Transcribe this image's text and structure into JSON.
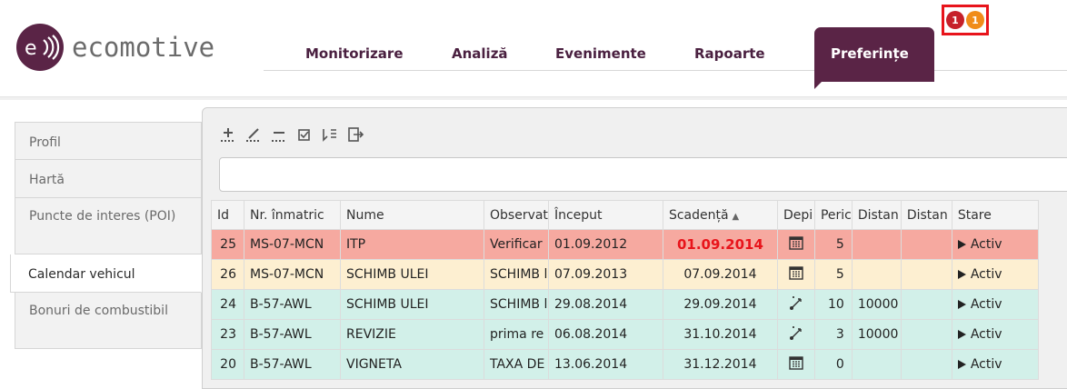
{
  "app": {
    "brand": "ecomotive"
  },
  "nav": {
    "items": [
      "Monitorizare",
      "Analiză",
      "Evenimente",
      "Rapoarte"
    ],
    "active": "Preferințe"
  },
  "notifications": {
    "badges": [
      "1",
      "1"
    ]
  },
  "sidebar": {
    "items": [
      {
        "label": "Profil"
      },
      {
        "label": "Hartă"
      },
      {
        "label": "Puncte de interes (POI)"
      },
      {
        "label": "Calendar vehicul"
      },
      {
        "label": "Bonuri de combustibil"
      }
    ],
    "active_index": 3
  },
  "toolbar": {
    "icons": [
      "add-icon",
      "edit-icon",
      "delete-icon",
      "select-icon",
      "sync-icon",
      "export-icon"
    ]
  },
  "search": {
    "value": "",
    "placeholder": ""
  },
  "table": {
    "columns": [
      "Id",
      "Nr. înmatric",
      "Nume",
      "Observat",
      "Început",
      "Scadență",
      "Depi",
      "Peric",
      "Distan",
      "Distan",
      "Stare"
    ],
    "sort_column_index": 5,
    "rows": [
      {
        "id": "25",
        "plate": "MS-07-MCN",
        "name": "ITP",
        "obs": "Verificar",
        "start": "01.09.2012",
        "due": "01.09.2014",
        "dep": "calendar-icon",
        "period": "5",
        "dist1": "",
        "dist2": "",
        "status": "Activ",
        "state": "overdue"
      },
      {
        "id": "26",
        "plate": "MS-07-MCN",
        "name": "SCHIMB ULEI",
        "obs": "SCHIMB l",
        "start": "07.09.2013",
        "due": "07.09.2014",
        "dep": "calendar-icon",
        "period": "5",
        "dist1": "",
        "dist2": "",
        "status": "Activ",
        "state": "warning"
      },
      {
        "id": "24",
        "plate": "B-57-AWL",
        "name": "SCHIMB ULEI",
        "obs": "SCHIMB l",
        "start": "29.08.2014",
        "due": "29.09.2014",
        "dep": "route-icon",
        "period": "10",
        "dist1": "10000",
        "dist2": "",
        "status": "Activ",
        "state": "ok"
      },
      {
        "id": "23",
        "plate": "B-57-AWL",
        "name": "REVIZIE",
        "obs": "prima re",
        "start": "06.08.2014",
        "due": "31.10.2014",
        "dep": "route-icon",
        "period": "3",
        "dist1": "10000",
        "dist2": "",
        "status": "Activ",
        "state": "ok"
      },
      {
        "id": "20",
        "plate": "B-57-AWL",
        "name": "VIGNETA",
        "obs": "TAXA DE",
        "start": "13.06.2014",
        "due": "31.12.2014",
        "dep": "calendar-icon",
        "period": "0",
        "dist1": "",
        "dist2": "",
        "status": "Activ",
        "state": "ok"
      }
    ]
  },
  "colors": {
    "brand": "#5a2446",
    "overdue_row": "#f6a9a0",
    "warning_row": "#fdefd1",
    "ok_row": "#d2f0e9",
    "overdue_text": "#e8141b"
  }
}
